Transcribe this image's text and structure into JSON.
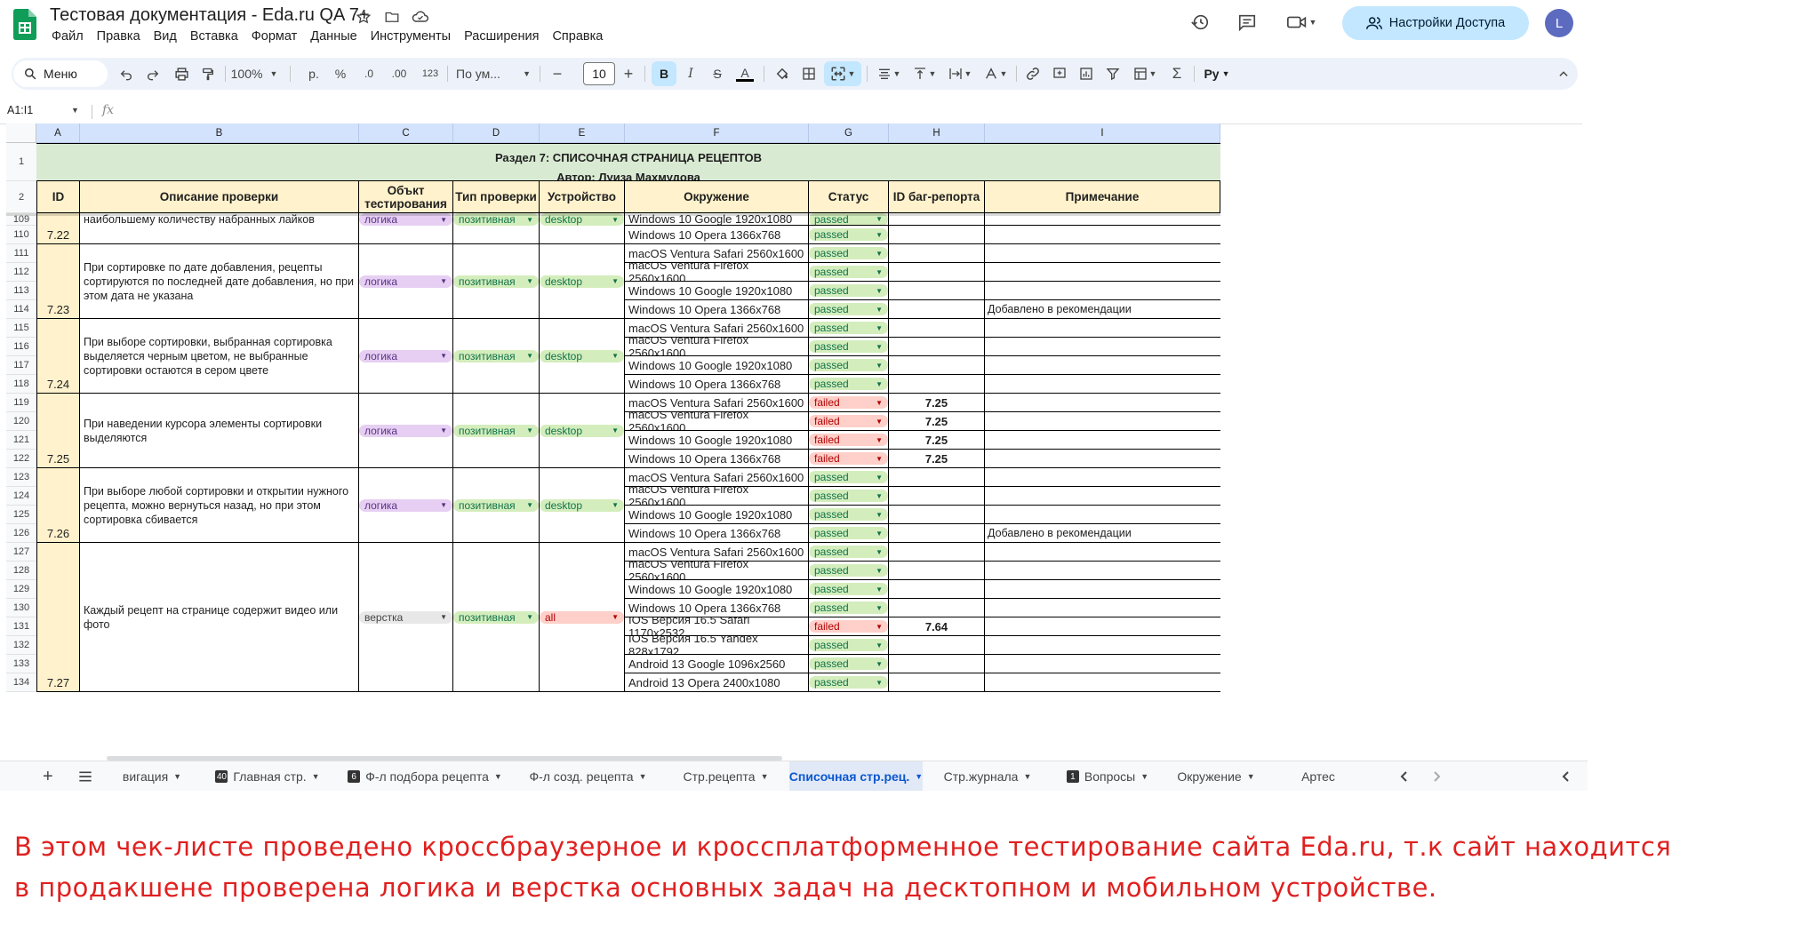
{
  "app": {
    "title": "Тестовая документация - Eda.ru QA 7+",
    "menu": [
      "Файл",
      "Правка",
      "Вид",
      "Вставка",
      "Формат",
      "Данные",
      "Инструменты",
      "Расширения",
      "Справка"
    ],
    "share_label": "Настройки Доступа",
    "avatar_letter": "L"
  },
  "toolbar": {
    "menu_label": "Меню",
    "zoom": "100%",
    "currency": "р.",
    "percent": "%",
    "dec_less": ".0",
    "dec_more": ".00",
    "format_123": "123",
    "font_label": "По ум...",
    "font_size": "10",
    "bold": "B",
    "italic": "I",
    "strike": "S",
    "text_color": "A",
    "script_label": "Py"
  },
  "formula": {
    "name_box": "A1:I1",
    "fx": "fx"
  },
  "columns": [
    "A",
    "B",
    "C",
    "D",
    "E",
    "F",
    "G",
    "H",
    "I"
  ],
  "banner": {
    "row_number": "1",
    "line1": "Раздел 7: СПИСОЧНАЯ СТРАНИЦА РЕЦЕПТОВ",
    "line2": "Автор: Луиза Махмудова"
  },
  "header": {
    "row_number": "2",
    "cells": [
      "ID",
      "Описание проверки",
      "Объкт тестирования",
      "Тип проверки",
      "Устройство",
      "Окружение",
      "Статус",
      "ID баг-репорта",
      "Примечание"
    ]
  },
  "row_numbers": [
    "109",
    "110",
    "111",
    "112",
    "113",
    "114",
    "115",
    "116",
    "117",
    "118",
    "119",
    "120",
    "121",
    "122",
    "123",
    "124",
    "125",
    "126",
    "127",
    "128",
    "129",
    "130",
    "131",
    "132",
    "133",
    "134"
  ],
  "groups": [
    {
      "id": "7.22",
      "description": "наибольшему количеству набранных лайков",
      "object": "логика",
      "type": "позитивная",
      "device": "desktop"
    },
    {
      "id": "7.23",
      "description": "При сортировке по дате добавления, рецепты сортируются по последней дате добавления, но при этом дата не указана",
      "object": "логика",
      "type": "позитивная",
      "device": "desktop"
    },
    {
      "id": "7.24",
      "description": "При выборе сортировки, выбранная сортировка выделяется черным цветом, не выбранные сортировки остаются в сером цвете",
      "object": "логика",
      "type": "позитивная",
      "device": "desktop"
    },
    {
      "id": "7.25",
      "description": "При наведении курсора элементы сортировки выделяются",
      "object": "логика",
      "type": "позитивная",
      "device": "desktop"
    },
    {
      "id": "7.26",
      "description": "При выборе любой сортировки и открытии нужного рецепта, можно вернуться назад, но при этом сортировка сбивается",
      "object": "логика",
      "type": "позитивная",
      "device": "desktop"
    },
    {
      "id": "7.27",
      "description": "Каждый рецепт на странице содержит видео или фото",
      "object": "верстка",
      "type": "позитивная",
      "device": "all"
    }
  ],
  "rows": [
    {
      "env": "Windows 10 Google 1920x1080",
      "status": "passed",
      "bug": "",
      "note": ""
    },
    {
      "env": "Windows 10 Opera 1366x768",
      "status": "passed",
      "bug": "",
      "note": ""
    },
    {
      "env": "macOS Ventura Safari 2560x1600",
      "status": "passed",
      "bug": "",
      "note": ""
    },
    {
      "env": "macOS Ventura Firefox 2560x1600",
      "status": "passed",
      "bug": "",
      "note": ""
    },
    {
      "env": "Windows 10 Google 1920x1080",
      "status": "passed",
      "bug": "",
      "note": ""
    },
    {
      "env": "Windows 10 Opera 1366x768",
      "status": "passed",
      "bug": "",
      "note": "Добавлено в рекомендации"
    },
    {
      "env": "macOS Ventura Safari 2560x1600",
      "status": "passed",
      "bug": "",
      "note": ""
    },
    {
      "env": "macOS Ventura Firefox 2560x1600",
      "status": "passed",
      "bug": "",
      "note": ""
    },
    {
      "env": "Windows 10 Google 1920x1080",
      "status": "passed",
      "bug": "",
      "note": ""
    },
    {
      "env": "Windows 10 Opera 1366x768",
      "status": "passed",
      "bug": "",
      "note": ""
    },
    {
      "env": "macOS Ventura Safari 2560x1600",
      "status": "failed",
      "bug": "7.25",
      "note": ""
    },
    {
      "env": "macOS Ventura Firefox 2560x1600",
      "status": "failed",
      "bug": "7.25",
      "note": ""
    },
    {
      "env": "Windows 10 Google 1920x1080",
      "status": "failed",
      "bug": "7.25",
      "note": ""
    },
    {
      "env": "Windows 10 Opera 1366x768",
      "status": "failed",
      "bug": "7.25",
      "note": ""
    },
    {
      "env": "macOS Ventura Safari 2560x1600",
      "status": "passed",
      "bug": "",
      "note": ""
    },
    {
      "env": "macOS Ventura Firefox 2560x1600",
      "status": "passed",
      "bug": "",
      "note": ""
    },
    {
      "env": "Windows 10 Google 1920x1080",
      "status": "passed",
      "bug": "",
      "note": ""
    },
    {
      "env": "Windows 10 Opera 1366x768",
      "status": "passed",
      "bug": "",
      "note": "Добавлено в рекомендации"
    },
    {
      "env": "macOS Ventura Safari 2560x1600",
      "status": "passed",
      "bug": "",
      "note": ""
    },
    {
      "env": "macOS Ventura Firefox 2560x1600",
      "status": "passed",
      "bug": "",
      "note": ""
    },
    {
      "env": "Windows 10 Google 1920x1080",
      "status": "passed",
      "bug": "",
      "note": ""
    },
    {
      "env": "Windows 10 Opera 1366x768",
      "status": "passed",
      "bug": "",
      "note": ""
    },
    {
      "env": "IOS Версия 16.5 Safari 1170x2532",
      "status": "failed",
      "bug": "7.64",
      "note": ""
    },
    {
      "env": "IOS Версия 16.5 Yandex  828x1792",
      "status": "passed",
      "bug": "",
      "note": ""
    },
    {
      "env": "Android 13 Google 1096x2560",
      "status": "passed",
      "bug": "",
      "note": ""
    },
    {
      "env": "Android 13 Opera 2400x1080",
      "status": "passed",
      "bug": "",
      "note": ""
    }
  ],
  "tabs": [
    {
      "label": "вигация",
      "badge": ""
    },
    {
      "label": "Главная стр.",
      "badge": "40"
    },
    {
      "label": "Ф-л подбора рецепта",
      "badge": "6"
    },
    {
      "label": "Ф-л созд. рецепта",
      "badge": ""
    },
    {
      "label": "Стр.рецепта",
      "badge": ""
    },
    {
      "label": "Списочная стр.рец.",
      "badge": ""
    },
    {
      "label": "Стр.журнала",
      "badge": ""
    },
    {
      "label": "Вопросы",
      "badge": "1"
    },
    {
      "label": "Окружение",
      "badge": ""
    },
    {
      "label": "Артес",
      "badge": ""
    }
  ],
  "caption": {
    "line1": "В этом чек-листе проведено кроссбраузерное и кроссплатформенное тестирование сайта Eda.ru, т.к сайт находится",
    "line2": "в продакшене проверена логика и верстка основных задач на десктопном и мобильном устройстве."
  },
  "colors": {
    "header_fill": "#fff2cc",
    "banner_fill": "#d9ead3",
    "passed": "#d4edbc",
    "failed": "#ffcfc9",
    "caption": "#e02020"
  }
}
